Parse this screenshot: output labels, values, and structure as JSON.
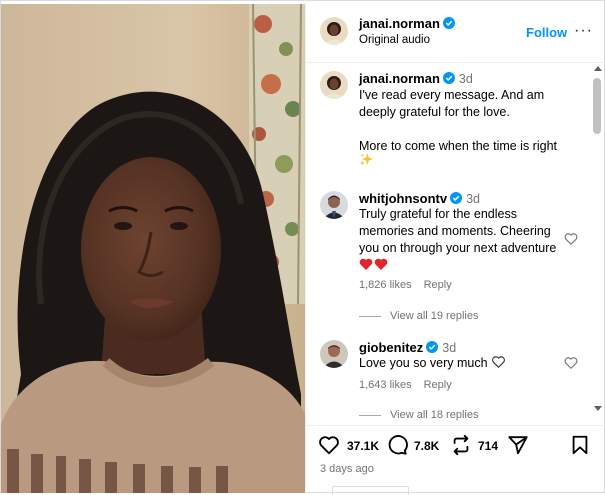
{
  "post": {
    "username": "janai.norman",
    "audio": "Original audio",
    "follow_label": "Follow",
    "more_label": "···"
  },
  "comments": [
    {
      "username": "janai.norman",
      "time": "3d",
      "text": "I've read every message. And am deeply grateful for the love.\n\nMore to come when the time is right",
      "emoji": "sparkles"
    },
    {
      "username": "whitjohnsontv",
      "time": "3d",
      "text": "Truly grateful for the endless memories and moments. Cheering you on through your next adventure",
      "emoji": "red-hearts",
      "likes": "1,826 likes",
      "reply_label": "Reply",
      "view_replies": "View all 19 replies"
    },
    {
      "username": "giobenitez",
      "time": "3d",
      "text": "Love you so very much",
      "emoji": "white-heart",
      "likes": "1,643 likes",
      "reply_label": "Reply",
      "view_replies": "View all 18 replies"
    }
  ],
  "actions": {
    "likes": "37.1K",
    "comments": "7.8K",
    "reposts": "714",
    "posted": "3 days ago"
  },
  "icons": [
    "verified-badge-icon",
    "heart-icon",
    "comment-icon",
    "repost-icon",
    "share-icon",
    "save-icon",
    "sparkles-emoji",
    "red-heart-emoji",
    "white-heart-emoji"
  ],
  "colors": {
    "accent": "#0095f6",
    "verified": "#0095f6",
    "muted": "#737373",
    "heart_red": "#e0252c"
  }
}
